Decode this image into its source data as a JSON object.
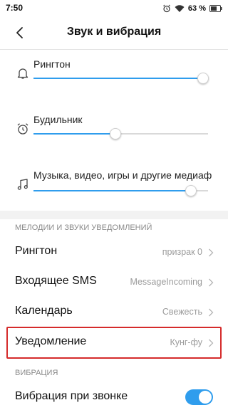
{
  "status_bar": {
    "time": "7:50",
    "battery_percent": "63 %",
    "icons": [
      "alarm-icon",
      "wifi-icon",
      "battery-icon"
    ]
  },
  "header": {
    "title": "Звук и вибрация",
    "back_icon": "back-arrow-icon"
  },
  "volume_sliders": [
    {
      "label": "Рингтон",
      "icon": "bell-icon",
      "level": 0.97
    },
    {
      "label": "Будильник",
      "icon": "alarm-clock-icon",
      "level": 0.47
    },
    {
      "label": "Музыка, видео, игры и другие медиафайлы",
      "icon": "music-note-icon",
      "level": 0.9
    }
  ],
  "sections": {
    "ringtones_header": "МЕЛОДИИ И ЗВУКИ УВЕДОМЛЕНИЙ",
    "vibration_header": "ВИБРАЦИЯ"
  },
  "ringtone_items": [
    {
      "label": "Рингтон",
      "value": "призрак 0"
    },
    {
      "label": "Входящее SMS",
      "value": "MessageIncoming"
    },
    {
      "label": "Календарь",
      "value": "Свежесть"
    },
    {
      "label": "Уведомление",
      "value": "Кунг-фу"
    }
  ],
  "vibration": {
    "label": "Вибрация при звонке",
    "enabled": true
  },
  "colors": {
    "accent": "#2f9ded",
    "highlight_border": "#d52b2b"
  }
}
